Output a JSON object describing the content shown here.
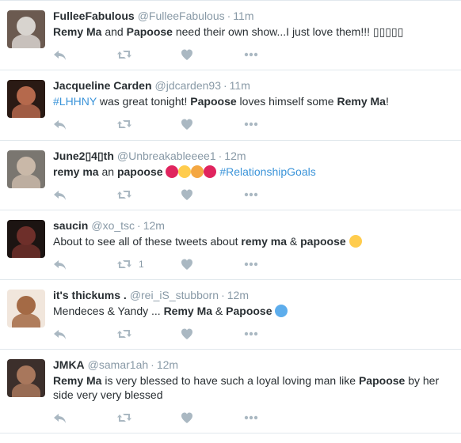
{
  "tweets": [
    {
      "name": "FulleeFabulous",
      "handle": "@FulleeFabulous",
      "time": "11m",
      "text": [
        {
          "t": "b",
          "v": "Remy Ma"
        },
        {
          "t": "s",
          "v": " and "
        },
        {
          "t": "b",
          "v": "Papoose"
        },
        {
          "t": "s",
          "v": " need their own show...I just love them!!! ▯▯▯▯▯"
        }
      ],
      "retweet_count": ""
    },
    {
      "name": "Jacqueline Carden",
      "handle": "@jdcarden93",
      "time": "11m",
      "text": [
        {
          "t": "h",
          "v": "#LHHNY"
        },
        {
          "t": "s",
          "v": " was great tonight!  "
        },
        {
          "t": "b",
          "v": "Papoose"
        },
        {
          "t": "s",
          "v": " loves himself some "
        },
        {
          "t": "b",
          "v": "Remy Ma"
        },
        {
          "t": "s",
          "v": "!"
        }
      ],
      "retweet_count": ""
    },
    {
      "name": "June2▯4▯th",
      "handle": "@Unbreakableeee1",
      "time": "12m",
      "text": [
        {
          "t": "b",
          "v": "remy ma"
        },
        {
          "t": "s",
          "v": " an "
        },
        {
          "t": "b",
          "v": "papoose"
        },
        {
          "t": "s",
          "v": " "
        },
        {
          "t": "e",
          "v": "#e0245e"
        },
        {
          "t": "e",
          "v": "#ffcc4d"
        },
        {
          "t": "e",
          "v": "#f4a742"
        },
        {
          "t": "e",
          "v": "#e0245e"
        },
        {
          "t": "s",
          "v": " "
        },
        {
          "t": "h",
          "v": "#RelationshipGoals"
        }
      ],
      "retweet_count": ""
    },
    {
      "name": "saucin",
      "handle": "@xo_tsc",
      "time": "12m",
      "text": [
        {
          "t": "s",
          "v": "About to see all of these tweets about "
        },
        {
          "t": "b",
          "v": "remy ma"
        },
        {
          "t": "s",
          "v": " & "
        },
        {
          "t": "b",
          "v": "papoose"
        },
        {
          "t": "s",
          "v": " "
        },
        {
          "t": "e",
          "v": "#ffcc4d"
        }
      ],
      "retweet_count": "1"
    },
    {
      "name": "it's thickums .",
      "handle": "@rei_iS_stubborn",
      "time": "12m",
      "text": [
        {
          "t": "s",
          "v": "Mendeces & Yandy ... "
        },
        {
          "t": "b",
          "v": "Remy Ma"
        },
        {
          "t": "s",
          "v": " & "
        },
        {
          "t": "b",
          "v": "Papoose"
        },
        {
          "t": "s",
          "v": " "
        },
        {
          "t": "e",
          "v": "#5dadec"
        }
      ],
      "retweet_count": ""
    },
    {
      "name": "JMKA",
      "handle": "@samar1ah",
      "time": "12m",
      "text": [
        {
          "t": "b",
          "v": "Remy Ma"
        },
        {
          "t": "s",
          "v": " is very blessed to have such a loyal loving man like "
        },
        {
          "t": "b",
          "v": "Papoose"
        },
        {
          "t": "s",
          "v": " by her side very very blessed"
        }
      ],
      "retweet_count": ""
    }
  ],
  "avatars": [
    {
      "bg": "#6b5a50",
      "fg": "#d8d4cf"
    },
    {
      "bg": "#2a1a14",
      "fg": "#b5694c"
    },
    {
      "bg": "#7a7670",
      "fg": "#c9b8a8"
    },
    {
      "bg": "#1c1412",
      "fg": "#6e2f2a"
    },
    {
      "bg": "#f1e6dc",
      "fg": "#a46a45"
    },
    {
      "bg": "#3c2f2b",
      "fg": "#a8775c"
    }
  ],
  "icons": {
    "reply": "reply-icon",
    "retweet": "retweet-icon",
    "like": "heart-icon",
    "more": "more-dots-icon"
  },
  "colors": {
    "hashtag": "#3b94d9",
    "meta": "#8899a6",
    "action": "#aab8c2",
    "divider": "#e1e8ed"
  }
}
